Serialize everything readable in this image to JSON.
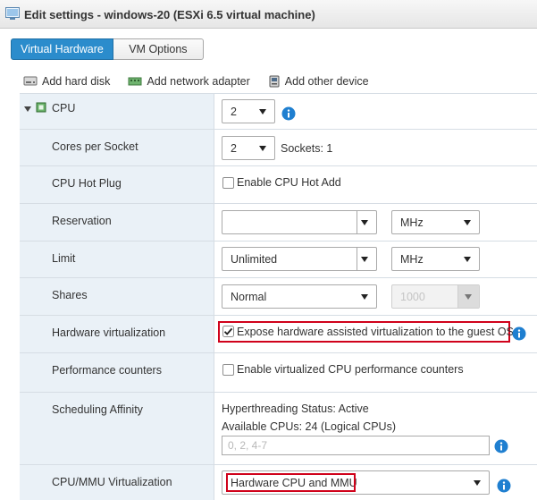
{
  "window": {
    "title": "Edit settings - windows-20 (ESXi 6.5 virtual machine)"
  },
  "tabs": [
    {
      "label": "Virtual Hardware",
      "active": true
    },
    {
      "label": "VM Options",
      "active": false
    }
  ],
  "toolbar": {
    "add_hard_disk": "Add hard disk",
    "add_network_adapter": "Add network adapter",
    "add_other_device": "Add other device"
  },
  "cpu": {
    "label": "CPU",
    "value": "2",
    "cores_per_socket": {
      "label": "Cores per Socket",
      "value": "2",
      "sockets_text": "Sockets: 1"
    },
    "hot_plug": {
      "label": "CPU Hot Plug",
      "checkbox_label": "Enable CPU Hot Add",
      "checked": false
    },
    "reservation": {
      "label": "Reservation",
      "value": "",
      "unit": "MHz"
    },
    "limit": {
      "label": "Limit",
      "value": "Unlimited",
      "unit": "MHz"
    },
    "shares": {
      "label": "Shares",
      "value": "Normal",
      "amount": "1000"
    },
    "hardware_virtualization": {
      "label": "Hardware virtualization",
      "checkbox_label": "Expose hardware assisted virtualization to the guest OS",
      "checked": true
    },
    "performance_counters": {
      "label": "Performance counters",
      "checkbox_label": "Enable virtualized CPU performance counters",
      "checked": false
    },
    "scheduling_affinity": {
      "label": "Scheduling Affinity",
      "hyperthreading_status": "Hyperthreading Status: Active",
      "available_cpus": "Available CPUs: 24 (Logical CPUs)",
      "placeholder": "0, 2, 4-7"
    },
    "mmu_virtualization": {
      "label": "CPU/MMU Virtualization",
      "value": "Hardware CPU and MMU"
    }
  },
  "colors": {
    "accent": "#2b8ccc",
    "label_bg": "#eaf1f7",
    "highlight": "#d0021b",
    "info_icon": "#1f7fd0"
  }
}
